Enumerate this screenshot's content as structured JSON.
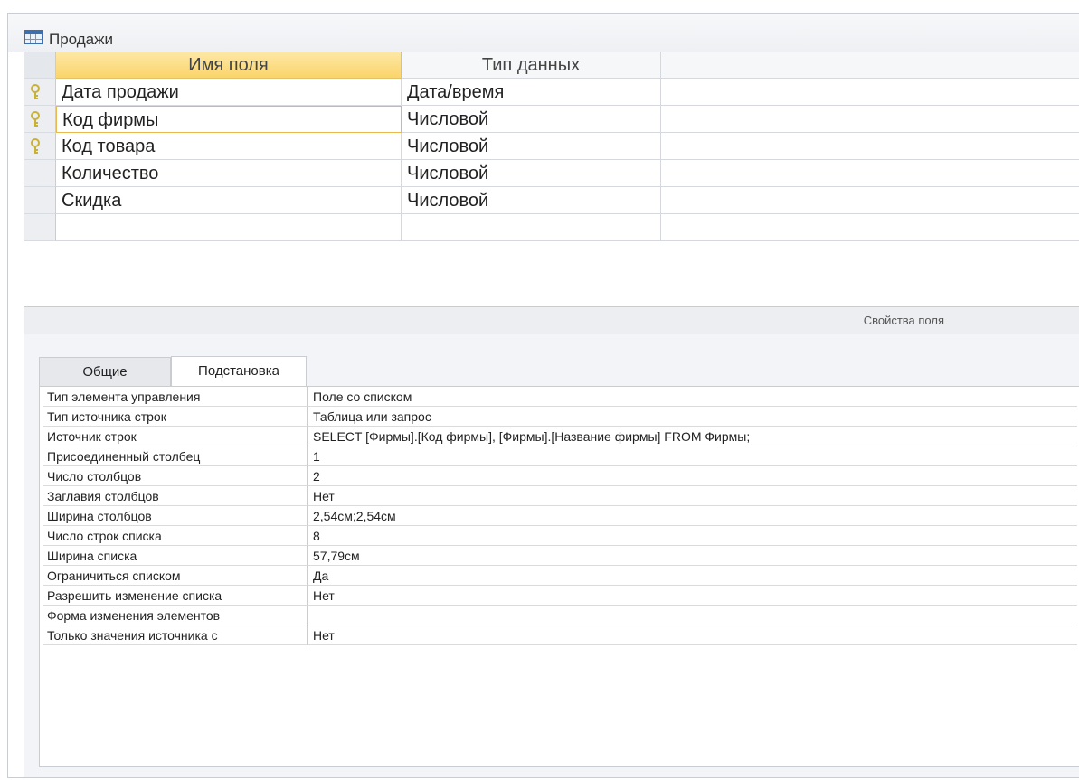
{
  "window": {
    "title": "Продажи"
  },
  "grid": {
    "headers": {
      "field_name": "Имя поля",
      "data_type": "Тип данных"
    },
    "rows": [
      {
        "name": "Дата продажи",
        "type": "Дата/время",
        "key": true
      },
      {
        "name": "Код фирмы",
        "type": "Числовой",
        "key": true,
        "current": true
      },
      {
        "name": "Код товара",
        "type": "Числовой",
        "key": true
      },
      {
        "name": "Количество",
        "type": "Числовой",
        "key": false
      },
      {
        "name": "Скидка",
        "type": "Числовой",
        "key": false
      },
      {
        "name": "",
        "type": "",
        "key": false
      }
    ]
  },
  "field_properties": {
    "label": "Свойства поля",
    "tabs": [
      "Общие",
      "Подстановка"
    ],
    "active_tab": "Подстановка",
    "rows": [
      {
        "name": "Тип элемента управления",
        "value": "Поле со списком"
      },
      {
        "name": "Тип источника строк",
        "value": "Таблица или запрос"
      },
      {
        "name": "Источник строк",
        "value": "SELECT [Фирмы].[Код фирмы], [Фирмы].[Название фирмы] FROM Фирмы;"
      },
      {
        "name": "Присоединенный столбец",
        "value": "1"
      },
      {
        "name": "Число столбцов",
        "value": "2"
      },
      {
        "name": "Заглавия столбцов",
        "value": "Нет"
      },
      {
        "name": "Ширина столбцов",
        "value": "2,54см;2,54см"
      },
      {
        "name": "Число строк списка",
        "value": "8"
      },
      {
        "name": "Ширина списка",
        "value": "57,79см"
      },
      {
        "name": "Ограничиться списком",
        "value": "Да"
      },
      {
        "name": "Разрешить изменение списка",
        "value": "Нет"
      },
      {
        "name": "Форма изменения элементов",
        "value": ""
      },
      {
        "name": "Только значения источника с",
        "value": "Нет"
      }
    ]
  },
  "icons": {
    "key": "key-icon",
    "row_pointer": "row-selector-arrow-icon",
    "table": "table-icon"
  },
  "colors": {
    "header_highlight": "#fbd56b",
    "key_icon": "#c8b236",
    "current_border": "#e9b94f"
  }
}
